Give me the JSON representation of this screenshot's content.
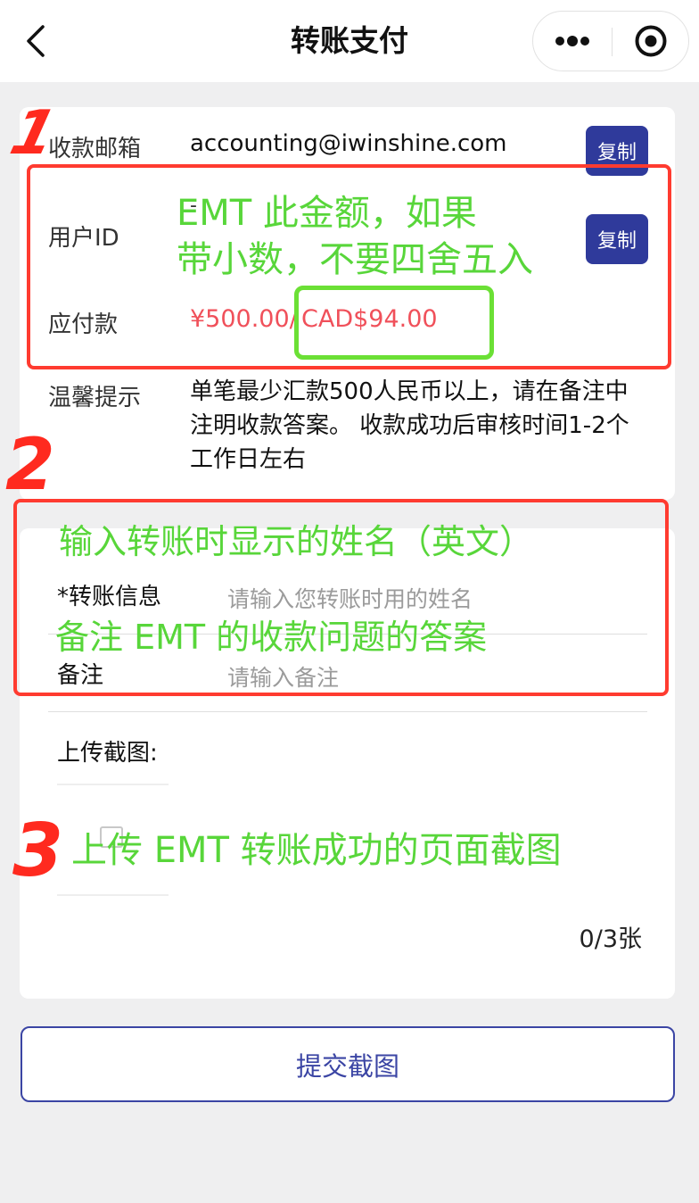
{
  "navbar": {
    "title": "转账支付"
  },
  "payment_info": {
    "email_label": "收款邮箱",
    "email_value": "accounting@iwinshine.com",
    "copy_label": "复制",
    "user_id_label": "用户ID",
    "user_id_value": "-",
    "amount_label": "应付款",
    "amount_cny": "¥500.00/",
    "amount_cad": "CAD$94.00",
    "tip_label": "温馨提示",
    "tip_text": "单笔最少汇款500人民币以上，请在备注中注明收款答案。 收款成功后审核时间1-2个工作日左右"
  },
  "form": {
    "transfer_info_label": "*转账信息",
    "transfer_info_placeholder": "请输入您转账时用的姓名",
    "remark_label": "备注",
    "remark_placeholder": "请输入备注",
    "upload_label": "上传截图:",
    "upload_count": "0/3张"
  },
  "submit": {
    "label": "提交截图"
  },
  "annotations": {
    "note1_line1": "EMT 此金额，如果",
    "note1_line2": "带小数，不要四舍五入",
    "note2": "输入转账时显示的姓名（英文）",
    "note2b": "备注 EMT 的收款问题的答案",
    "note3": "上传 EMT 转账成功的页面截图",
    "step1": "1",
    "step2": "2",
    "step3": "3"
  },
  "colors": {
    "accent": "#2f3a9b",
    "amount": "#f0505a",
    "annotation_green": "#58d63a",
    "annotation_red": "#ff2a1f"
  }
}
